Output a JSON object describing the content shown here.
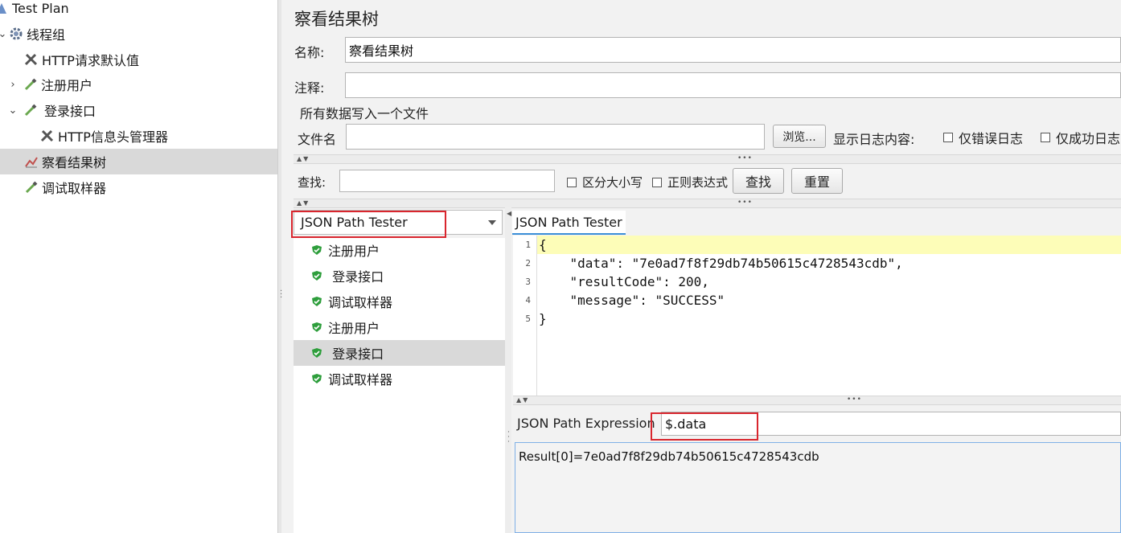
{
  "tree": {
    "items": [
      {
        "label": "Test Plan",
        "icon": "test-plan-icon",
        "toggle": ""
      },
      {
        "label": "线程组",
        "icon": "gear-icon",
        "toggle": "⌄"
      },
      {
        "label": "HTTP请求默认值",
        "icon": "wrench-icon",
        "toggle": ""
      },
      {
        "label": "注册用户",
        "icon": "pipette-icon",
        "toggle": "›"
      },
      {
        "label": "登录接口",
        "icon": "pipette-icon",
        "toggle": "⌄"
      },
      {
        "label": "HTTP信息头管理器",
        "icon": "wrench-icon",
        "toggle": ""
      },
      {
        "label": "察看结果树",
        "icon": "chart-icon",
        "toggle": ""
      },
      {
        "label": "调试取样器",
        "icon": "pipette-icon",
        "toggle": ""
      }
    ]
  },
  "panel": {
    "title": "察看结果树",
    "name_label": "名称:",
    "name_value": "察看结果树",
    "comment_label": "注释:",
    "comment_value": "",
    "file_section": "所有数据写入一个文件",
    "file_label": "文件名",
    "file_value": "",
    "browse_button": "浏览...",
    "log_label": "显示日志内容:",
    "errors_only": "仅错误日志",
    "success_only": "仅成功日志"
  },
  "search": {
    "label": "查找:",
    "value": "",
    "case_sensitive": "区分大小写",
    "regex": "正则表达式",
    "find_button": "查找",
    "reset_button": "重置"
  },
  "renderer": {
    "selected": "JSON Path Tester"
  },
  "results": [
    {
      "label": "注册用户"
    },
    {
      "label": " 登录接口"
    },
    {
      "label": "调试取样器"
    },
    {
      "label": "注册用户"
    },
    {
      "label": " 登录接口"
    },
    {
      "label": "调试取样器"
    }
  ],
  "viewer": {
    "tab": "JSON Path Tester",
    "line_numbers": [
      "1",
      "2",
      "3",
      "4",
      "5"
    ],
    "code_lines": [
      "{",
      "    \"data\": \"7e0ad7f8f29db74b50615c4728543cdb\",",
      "    \"resultCode\": 200,",
      "    \"message\": \"SUCCESS\"",
      "}"
    ],
    "expression_label": "JSON Path Expression",
    "expression_value": "$.data",
    "result": "Result[0]=7e0ad7f8f29db74b50615c4728543cdb"
  },
  "colors": {
    "selection": "#d9d9d9",
    "highlight_line": "#fdfdb8",
    "annotation_red": "#d9262e",
    "check_green": "#2e9e3c"
  }
}
